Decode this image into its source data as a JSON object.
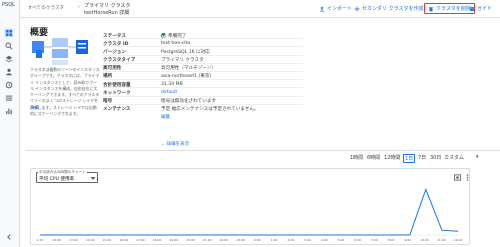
{
  "rail": {
    "label": "PSQL",
    "icons": [
      "dashboard-icon",
      "search-icon",
      "layers-icon",
      "users-icon",
      "backup-icon",
      "list-icon",
      "chart-icon",
      "folder-icon"
    ]
  },
  "header": {
    "breadcrumb_parent": "すべてのクラスタ",
    "breadcrumb_sep": "›",
    "title_line1": "プライマリ クラスタ",
    "title_line2": "testHorseRun 詳細",
    "import_label": "インポート",
    "promote_label": "セカンダリ クラスタを作成",
    "delete_label": "クラスタを削除",
    "guide_label": "ガイド"
  },
  "overview": {
    "title": "概要",
    "description": "クラスタは複数のゾーンのインスタンス グループです。クラスタには、プライマリ インスタンスとして、読み取りプール インスタンスを構成。自由自在にスケーリングできます。すべてのクラスタ リソースは 1 つのストレージ レイヤを共有します。ストレージ レイヤは自動的にスケーリングされます。",
    "learn_more": "詳細"
  },
  "properties": [
    {
      "key": "ステータス",
      "value": "準備完了"
    },
    {
      "key": "クラスタ ID",
      "value": "test-hoe-clta"
    },
    {
      "key": "バージョン",
      "value": "PostgreSQL 16 に対応"
    },
    {
      "key": "クラスタタイプ",
      "value": "プライマリ クラスタ"
    },
    {
      "key": "高可用性",
      "value": "高可用性（マルチゾーン）"
    },
    {
      "key": "場所",
      "value": "asia-northeast1 (東京)"
    },
    {
      "key": "合計使用容量",
      "value": "31.34 MB"
    },
    {
      "key": "ネットワーク",
      "value": "default"
    },
    {
      "key": "暗号",
      "value": "暗号は無効化されています"
    }
  ],
  "maintenance": {
    "key": "メンテナンス",
    "value": "予定 幅広メンテナンスは予定されていません。",
    "edit": "編集"
  },
  "details_link": "詳細を表示",
  "time_ranges": [
    "1時間",
    "6時間",
    "12時間",
    "1日",
    "7日",
    "30日",
    "カスタム"
  ],
  "selected_range": "1日",
  "chart": {
    "metric_label": "平均読み込み時間のチャート",
    "metric_value": "平均 CPU 使用率",
    "x_ticks": [
      "1:15",
      "12:00",
      "13:00",
      "14:00",
      "15:00",
      "16:00",
      "17:00",
      "18:00",
      "19:00",
      "20:00",
      "21:00",
      "22:00",
      "23:00",
      "0:00",
      "1:00",
      "2:00",
      "3:00",
      "4:00",
      "5:00",
      "6:00",
      "7:00",
      "8:00",
      "9:00",
      "10:00",
      "11:00",
      "12:00"
    ]
  },
  "chart_data": {
    "type": "line",
    "series": [
      {
        "values": [
          0,
          0,
          0,
          0,
          0,
          0,
          0,
          0,
          0,
          0,
          0,
          0,
          0,
          0,
          0,
          0,
          0,
          0,
          0,
          0,
          0,
          0,
          0,
          0,
          0.95,
          0.1,
          0.08
        ]
      }
    ]
  },
  "colors": {
    "accent": "#1a73e8",
    "danger": "#e53935",
    "ok": "#1e8e3e"
  }
}
